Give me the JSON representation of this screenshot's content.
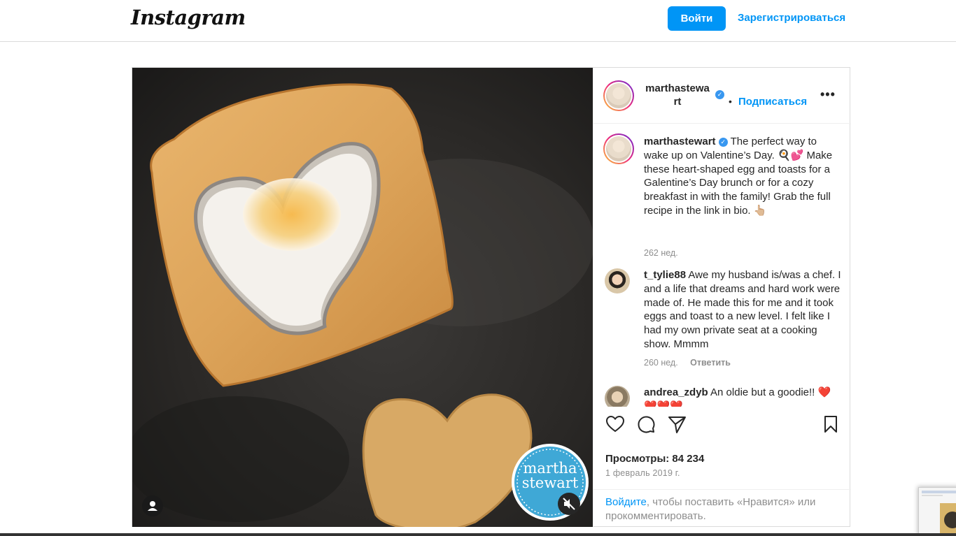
{
  "header": {
    "logo_text": "Instagram",
    "login_label": "Войти",
    "signup_label": "Зарегистрироваться"
  },
  "post_header": {
    "username_line1": "marthastewa",
    "username_line2": "rt",
    "separator": "•",
    "follow_label": "Подписаться",
    "more_label": "•••"
  },
  "caption": {
    "username": "marthastewart",
    "text": " The perfect way to wake up on Valentine’s Day. 🍳💕 Make these heart-shaped egg and toasts for a Galentine’s Day brunch or for a cozy breakfast in with the family! Grab the full recipe in the link in bio. 👆🏼",
    "age": "262 нед."
  },
  "comments": [
    {
      "username": "t_tylie88",
      "text": " Awe my husband is/was a chef. I and a life that dreams and hard work were made of. He made this for me and it took eggs and toast to a new level. I felt like I had my own private seat at a cooking show. Mmmm",
      "age": "260 нед.",
      "reply_label": "Ответить"
    },
    {
      "username": "andrea_zdyb",
      "text": " An oldie but a goodie!! ❤️❤️❤️❤️"
    }
  ],
  "actions": {
    "like_icon": "heart-icon",
    "comment_icon": "comment-icon",
    "share_icon": "paper-plane-icon",
    "save_icon": "bookmark-icon"
  },
  "stats": {
    "views_label": "Просмотры: 84 234",
    "date": "1 февраль 2019 г."
  },
  "login_note": {
    "link_text": "Войдите",
    "rest_text": ", чтобы поставить «Нравится» или прокомментировать."
  },
  "media": {
    "watermark_line1": "martha",
    "watermark_line2": "stewart"
  },
  "colors": {
    "accent": "#0095f6",
    "verified": "#3897f0",
    "muted": "#8e8e8e"
  }
}
